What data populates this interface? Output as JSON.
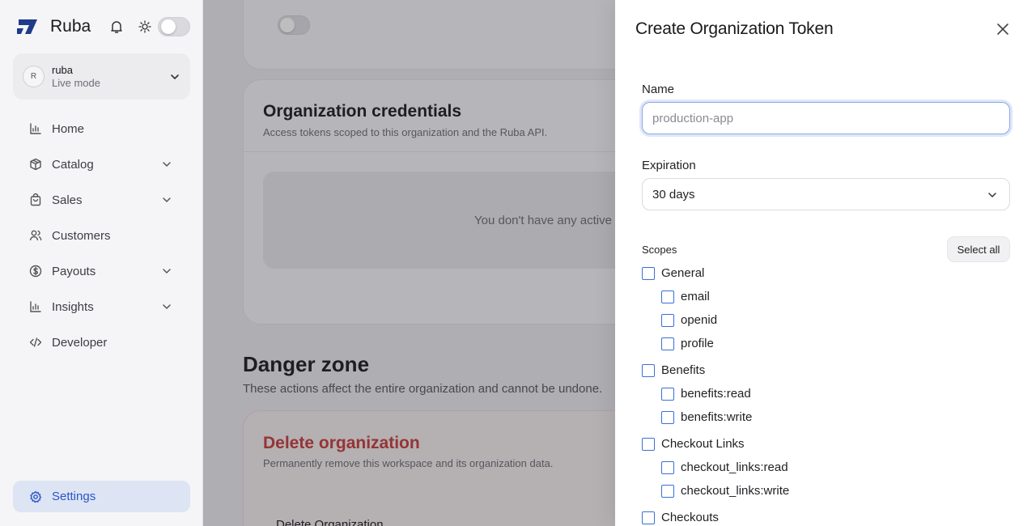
{
  "sidebar": {
    "brand_name": "Ruba",
    "org": {
      "avatar_initial": "R",
      "name": "ruba",
      "mode": "Live mode"
    },
    "nav": [
      {
        "label": "Home",
        "icon": "chart-icon",
        "has_chevron": false
      },
      {
        "label": "Catalog",
        "icon": "box-icon",
        "has_chevron": true
      },
      {
        "label": "Sales",
        "icon": "bag-icon",
        "has_chevron": true
      },
      {
        "label": "Customers",
        "icon": "users-icon",
        "has_chevron": false
      },
      {
        "label": "Payouts",
        "icon": "dollar-icon",
        "has_chevron": true
      },
      {
        "label": "Insights",
        "icon": "chart-icon",
        "has_chevron": true
      },
      {
        "label": "Developer",
        "icon": "code-icon",
        "has_chevron": false
      }
    ],
    "settings_label": "Settings"
  },
  "main": {
    "credentials": {
      "title": "Organization credentials",
      "subtitle": "Access tokens scoped to this organization and the Ruba API.",
      "empty_text": "You don't have any active"
    },
    "danger": {
      "title": "Danger zone",
      "subtitle": "These actions affect the entire organization and cannot be undone.",
      "delete_title": "Delete organization",
      "delete_subtitle": "Permanently remove this workspace and its organization data.",
      "delete_button": "Delete Organization"
    }
  },
  "drawer": {
    "title": "Create Organization Token",
    "name_label": "Name",
    "name_placeholder": "production-app",
    "name_value": "",
    "expiration_label": "Expiration",
    "expiration_value": "30 days",
    "scopes_label": "Scopes",
    "select_all_label": "Select all",
    "scopes": [
      {
        "label": "General",
        "level": 0,
        "checked": false
      },
      {
        "label": "email",
        "level": 1,
        "checked": false
      },
      {
        "label": "openid",
        "level": 1,
        "checked": false
      },
      {
        "label": "profile",
        "level": 1,
        "checked": false
      },
      {
        "label": "Benefits",
        "level": 0,
        "checked": false
      },
      {
        "label": "benefits:read",
        "level": 1,
        "checked": false
      },
      {
        "label": "benefits:write",
        "level": 1,
        "checked": false
      },
      {
        "label": "Checkout Links",
        "level": 0,
        "checked": false
      },
      {
        "label": "checkout_links:read",
        "level": 1,
        "checked": false
      },
      {
        "label": "checkout_links:write",
        "level": 1,
        "checked": false
      },
      {
        "label": "Checkouts",
        "level": 0,
        "checked": false
      }
    ]
  },
  "colors": {
    "accent": "#3b6fd8",
    "danger": "#c43a3a",
    "settings_active_bg": "#dde4f3"
  }
}
